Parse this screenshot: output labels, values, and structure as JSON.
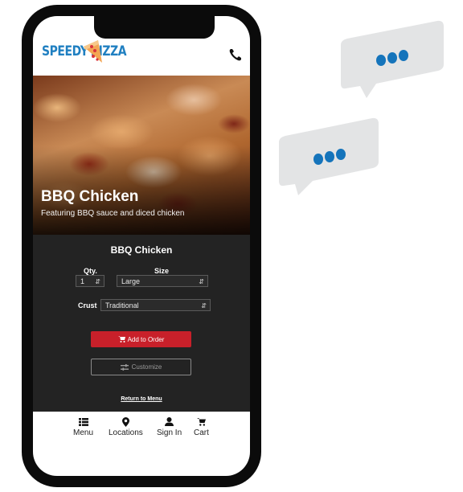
{
  "brand": {
    "logo_left": "SPEEDY",
    "logo_right": "PIZZA",
    "primary_color": "#1f7fc1",
    "accent_color": "#c8202a"
  },
  "header": {
    "phone_icon": "phone-icon"
  },
  "hero": {
    "title": "BBQ Chicken",
    "subtitle": "Featuring BBQ sauce and diced chicken"
  },
  "order_panel": {
    "title": "BBQ Chicken",
    "qty_label": "Qty.",
    "qty_value": "1",
    "size_label": "Size",
    "size_value": "Large",
    "crust_label": "Crust",
    "crust_value": "Traditional",
    "add_button": "Add to Order",
    "customize_button": "Customize",
    "return_link": "Return to Menu"
  },
  "bottom_nav": {
    "items": [
      {
        "label": "Menu",
        "icon": "list-icon"
      },
      {
        "label": "Locations",
        "icon": "map-pin-icon"
      },
      {
        "label": "Sign In",
        "icon": "user-icon"
      },
      {
        "label": "Cart",
        "icon": "cart-icon"
      }
    ]
  },
  "decor": {
    "bubble_color": "#e3e4e5",
    "dot_color": "#1574bb"
  }
}
